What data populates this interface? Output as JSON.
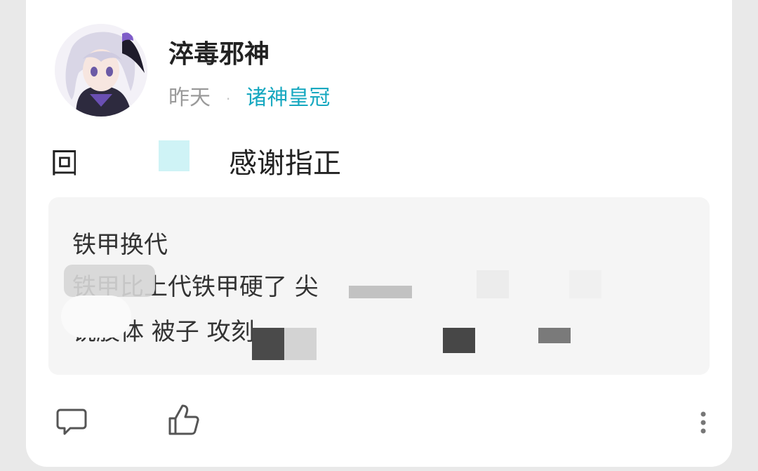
{
  "post": {
    "author_name": "淬毒邪神",
    "time": "昨天",
    "separator": "·",
    "forum": "诸神皇冠"
  },
  "reply": {
    "prefix": "回",
    "text": "感谢指正"
  },
  "quote": {
    "title": "铁甲换代",
    "line1": "铁甲比上代铁甲硬了                              尖",
    "line2": "锐肢体                                     被子  攻刻…"
  },
  "actions": {
    "comment_icon": "comment-icon",
    "like_icon": "thumbs-up-icon",
    "more_icon": "more-vertical-icon"
  },
  "colors": {
    "forum_accent": "#17a8c0",
    "mention_highlight": "#cff3f6",
    "quote_background": "#f5f5f5"
  }
}
